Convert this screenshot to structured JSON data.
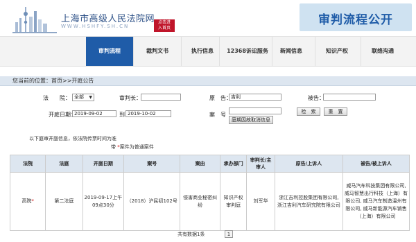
{
  "header": {
    "site_name": "上海市高级人民法院网",
    "site_url": "WWW.HSHFY.SH.CN",
    "enter_button": [
      "点击进",
      "入首页"
    ],
    "banner_title": "审判流程公开"
  },
  "nav": {
    "items": [
      {
        "label": "审判流程",
        "active": true
      },
      {
        "label": "裁判文书"
      },
      {
        "label": "执行信息"
      },
      {
        "label": "12368诉讼服务"
      },
      {
        "label": "新闻信息"
      },
      {
        "label": "知识产权"
      },
      {
        "label": "联络沟通"
      }
    ]
  },
  "breadcrumb": "您当前的位置：首页>>开庭公告",
  "search": {
    "court_label": "法　　院：",
    "court_value": "全部",
    "judge_label": "审判长：",
    "plaintiff_label": "原　告：",
    "plaintiff_value": "吉利",
    "defendant_label": "被告：",
    "date_label": "开庭日期：",
    "date_from": "2019-09-02",
    "date_to_label": "到",
    "date_to": "2019-10-02",
    "case_no_label": "案　号",
    "cancel_label": "庭期因故取消信息",
    "search_button": "检　索",
    "reset_button": "重　置"
  },
  "notes": {
    "info": "以下庭审开庭信息，依法院传票时间为准",
    "legend": "带 ",
    "legend_star": "*",
    "legend_rest": "案件为普通案件"
  },
  "table": {
    "headers": [
      "法院",
      "法庭",
      "开庭日期",
      "案号",
      "案由",
      "承办部门",
      "审判长/主审人",
      "原告/上诉人",
      "被告/被上诉人"
    ],
    "rows": [
      {
        "court": "高院",
        "court_star": "*",
        "tribunal": "第二法庭",
        "date": "2019-09-17上午09点30分",
        "case_no": "（2018）沪民初102号",
        "cause": "侵害商业秘密纠纷",
        "dept": "知识产权审判庭",
        "judge": "刘军华",
        "plaintiff": "浙江吉利控股集团有限公司, 浙江吉利汽车研究院有限公司",
        "defendant": "威马汽车科技集团有限公司, 威马智慧出行科技（上海）有限公司, 威马汽车制造温州有限公司, 威马新能源汽车销售（上海）有限公司"
      }
    ]
  },
  "pager": {
    "total_text": "共有数据1条",
    "page": "1"
  }
}
